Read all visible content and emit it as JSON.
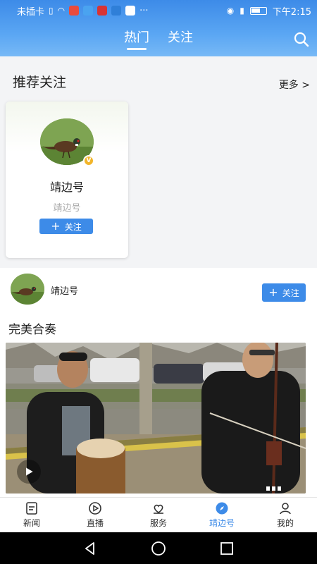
{
  "status_bar": {
    "carrier": "未插卡",
    "time": "下午2:15",
    "more": "···"
  },
  "header": {
    "tabs": [
      {
        "label": "热门",
        "active": true
      },
      {
        "label": "关注",
        "active": false
      }
    ],
    "search_icon": "search-icon"
  },
  "recommend": {
    "title": "推荐关注",
    "more": "更多 >",
    "card": {
      "name": "靖边号",
      "subtitle": "靖边号",
      "verified_badge": "V",
      "follow_label": "关注"
    }
  },
  "feed": {
    "author": "靖边号",
    "follow_label": "关注",
    "post_title": "完美合奏"
  },
  "bottom_nav": [
    {
      "label": "新闻",
      "icon": "news-icon",
      "active": false
    },
    {
      "label": "直播",
      "icon": "live-icon",
      "active": false
    },
    {
      "label": "服务",
      "icon": "service-icon",
      "active": false
    },
    {
      "label": "靖边号",
      "icon": "compass-icon",
      "active": true
    },
    {
      "label": "我的",
      "icon": "profile-icon",
      "active": false
    }
  ],
  "colors": {
    "accent": "#3d8be8",
    "header_gradient_top": "#3d8be8",
    "header_gradient_bottom": "#77b9f6"
  }
}
